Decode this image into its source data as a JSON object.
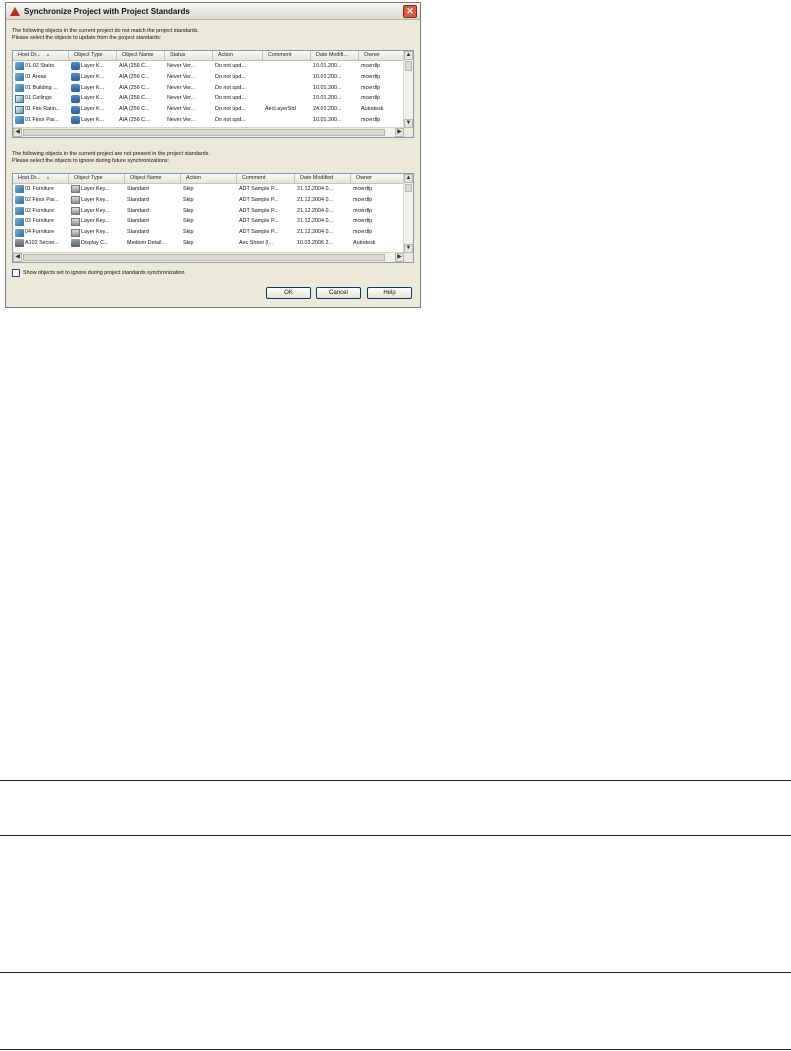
{
  "dialog": {
    "title": "Synchronize Project with Project Standards",
    "close_glyph": "✕",
    "intro_top": [
      "The following objects in the current project do not match the project standards.",
      "Please select the objects to update from the project standards:"
    ],
    "intro_bottom": [
      "The following objects in the current project are not present in the project standards.",
      "Please select the objects to ignore during future synchronizations:"
    ],
    "top_table": {
      "headers": [
        "Host Dr...",
        "Object Type",
        "Object Name",
        "Status",
        "Action",
        "Comment",
        "Date Modifi...",
        "Owner"
      ],
      "rows": [
        {
          "icon": "layer-key-style-icon",
          "cells": [
            "01-02 Stairs",
            "Layer K...",
            "AIA (256 C...",
            "Never Ver...",
            "Do not upd...",
            "",
            "10.01.200...",
            "mcerdlp"
          ]
        },
        {
          "icon": "layer-key-style-icon",
          "cells": [
            "01 Areas",
            "Layer K...",
            "AIA (256 C...",
            "Never Ver...",
            "Do not upd...",
            "",
            "10.01.200...",
            "mcerdlp"
          ]
        },
        {
          "icon": "layer-key-style-icon",
          "cells": [
            "01 Building ...",
            "Layer K...",
            "AIA (256 C...",
            "Never Ver...",
            "Do not upd...",
            "",
            "10.01.200...",
            "mcerdlp"
          ]
        },
        {
          "icon": "standards-icon",
          "cells": [
            "01 Ceilings",
            "Layer K...",
            "AIA (256 C...",
            "Never Ver...",
            "Do not upd...",
            "",
            "10.01.200...",
            "mcerdlp"
          ]
        },
        {
          "icon": "standards-icon",
          "cells": [
            "01 Fire Ratin...",
            "Layer K...",
            "AIA (256 C...",
            "Never Ver...",
            "Do not upd...",
            "AecLayerStd",
            "24.01.200...",
            "Autodesk"
          ]
        },
        {
          "icon": "layer-key-style-icon",
          "cells": [
            "01 Floor Par...",
            "Layer K...",
            "AIA (256 C...",
            "Never Ver...",
            "Do not upd...",
            "",
            "10.01.200...",
            "mcerdlp"
          ]
        }
      ]
    },
    "bottom_table": {
      "headers": [
        "Host Dr...",
        "Object Type",
        "Object Name",
        "Action",
        "Comment",
        "Date Modified",
        "Owner"
      ],
      "rows": [
        {
          "icon": "layer-key-style-icon",
          "cells": [
            "01 Furniture",
            "Layer Key...",
            "Standard",
            "Skip",
            "ADT Sample P...",
            "21.12.2004 0...",
            "mcerdlp"
          ]
        },
        {
          "icon": "layer-key-style-icon",
          "cells": [
            "02 Floor Par...",
            "Layer Key...",
            "Standard",
            "Skip",
            "ADT Sample P...",
            "21.12.2004 0...",
            "mcerdlp"
          ]
        },
        {
          "icon": "layer-key-style-icon",
          "cells": [
            "02 Furniture",
            "Layer Key...",
            "Standard",
            "Skip",
            "ADT Sample P...",
            "21.12.2004 0...",
            "mcerdlp"
          ]
        },
        {
          "icon": "layer-key-style-icon",
          "cells": [
            "03 Furniture",
            "Layer Key...",
            "Standard",
            "Skip",
            "ADT Sample P...",
            "21.12.2004 0...",
            "mcerdlp"
          ]
        },
        {
          "icon": "layer-key-style-icon",
          "cells": [
            "04 Furniture",
            "Layer Key...",
            "Standard",
            "Skip",
            "ADT Sample P...",
            "21.12.2004 0...",
            "mcerdlp"
          ]
        },
        {
          "icon": "display-configuration-icon",
          "cells": [
            "A102 Secon...",
            "Display C...",
            "Medium Detail...",
            "Skip",
            "Aec Sheet (l...",
            "10.03.2006 2...",
            "Autodesk"
          ]
        }
      ]
    },
    "checkbox_label": "Show objects set to ignore during project standards synchronization",
    "buttons": {
      "ok": "OK",
      "cancel": "Cancel",
      "help": "Help"
    }
  }
}
